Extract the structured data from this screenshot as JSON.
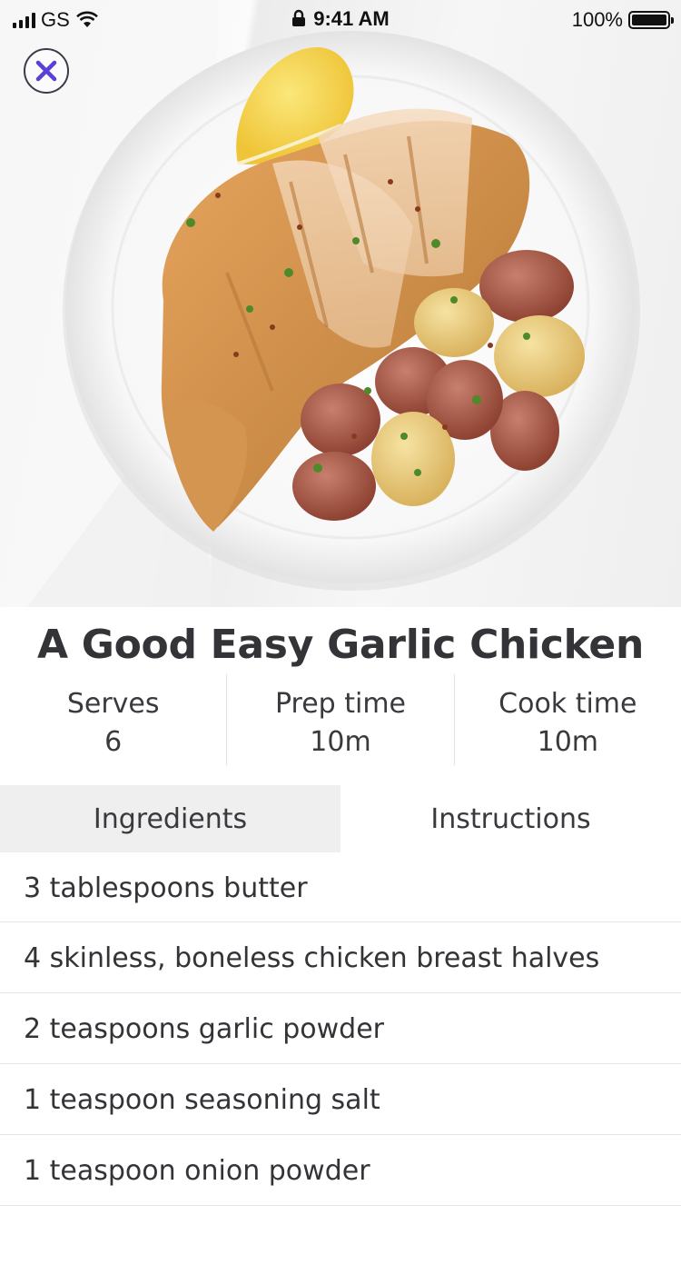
{
  "status_bar": {
    "carrier": "GS",
    "time": "9:41 AM",
    "battery_percent": "100%",
    "icons": [
      "signal-icon",
      "wifi-icon",
      "lock-icon",
      "battery-icon"
    ]
  },
  "hero": {
    "close_icon": "close-icon",
    "accent_color": "#5b3fd6"
  },
  "recipe": {
    "title": "A Good Easy Garlic Chicken",
    "meta": [
      {
        "label": "Serves",
        "value": "6"
      },
      {
        "label": "Prep time",
        "value": "10m"
      },
      {
        "label": "Cook time",
        "value": "10m"
      }
    ]
  },
  "tabs": [
    {
      "label": "Ingredients",
      "selected": true
    },
    {
      "label": "Instructions",
      "selected": false
    }
  ],
  "ingredients": [
    "3 tablespoons butter",
    "4 skinless, boneless chicken breast halves",
    "2 teaspoons garlic powder",
    "1 teaspoon seasoning salt",
    "1 teaspoon onion powder"
  ]
}
